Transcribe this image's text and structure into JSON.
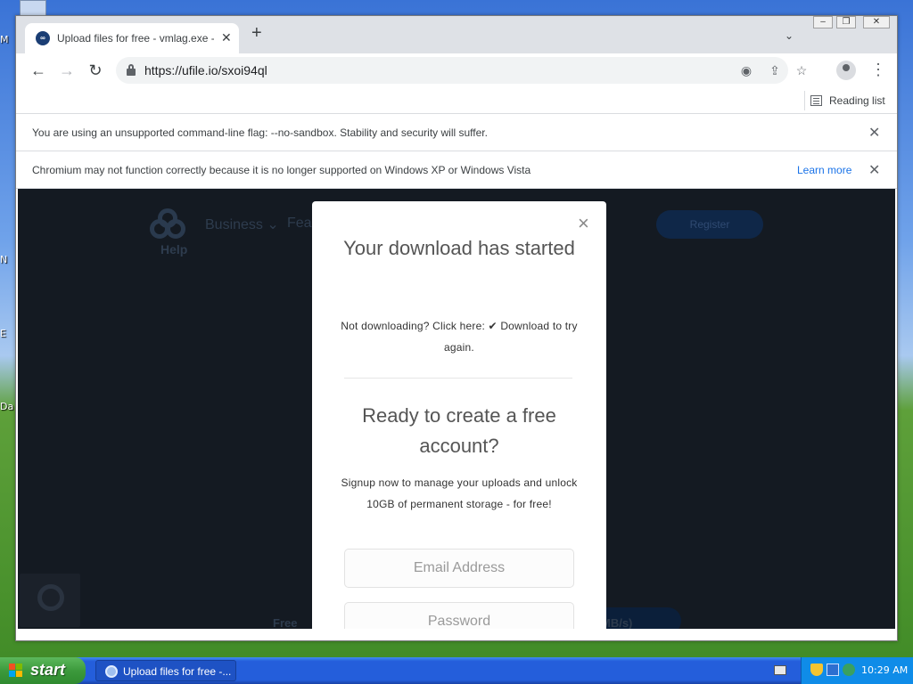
{
  "desktop": {
    "icon_labels": [
      "M",
      "N",
      "E",
      "Da"
    ]
  },
  "browser": {
    "tab": {
      "title": "Upload files for free - vmlag.exe - u",
      "favicon": "ufile-logo-icon"
    },
    "new_tab_symbol": "+",
    "tab_search_symbol": "⌄",
    "window_controls": {
      "minimize": "–",
      "restore": "❐",
      "close": "✕"
    },
    "address": {
      "url": "https://ufile.io/sxoi94ql"
    },
    "reading_list_label": "Reading list",
    "infobars": [
      {
        "text": "You are using an unsupported command-line flag: --no-sandbox. Stability and security will suffer."
      },
      {
        "text": "Chromium may not function correctly because it is no longer supported on Windows XP or Windows Vista",
        "link": "Learn more"
      }
    ]
  },
  "page": {
    "help_label": "Help",
    "nav_items": [
      "Business ⌄",
      "Fea"
    ],
    "register_label": "Register",
    "bottom_left_text": "Free",
    "bottom_right_text": "MB/s)"
  },
  "modal": {
    "close_symbol": "×",
    "title": "Your download has started",
    "not_downloading_prefix": "Not downloading? Click here: ",
    "download_link": "✔ Download",
    "not_downloading_suffix": " to try again.",
    "signup_title": "Ready to create a free account?",
    "signup_text": "Signup now to manage your uploads and unlock 10GB of permanent storage - for free!",
    "email_placeholder": "Email Address",
    "password_placeholder": "Password"
  },
  "taskbar": {
    "start_label": "start",
    "task_item_label": "Upload files for free -...",
    "clock": "10:29 AM"
  },
  "colors": {
    "accent_link": "#1a73e8",
    "page_dark": "#141a22",
    "taskbar_blue": "#245edb",
    "start_green": "#3c9a3c"
  }
}
